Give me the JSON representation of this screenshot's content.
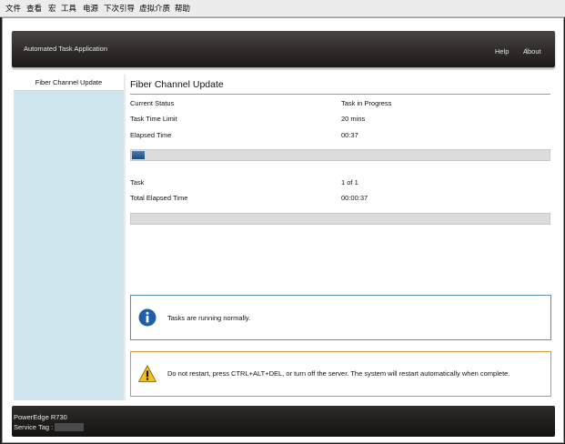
{
  "menu": [
    "文件",
    "查看",
    "宏",
    "工具",
    "电源",
    "下次引导",
    "虚拟介质",
    "帮助"
  ],
  "header": {
    "app_title": "Automated Task Application",
    "help": "Help",
    "about": "About",
    "separator": "|"
  },
  "sidebar": {
    "items": [
      {
        "label": "Fiber Channel Update"
      }
    ]
  },
  "main": {
    "title": "Fiber Channel Update",
    "current_status_label": "Current Status",
    "current_status_value": "Task in Progress",
    "time_limit_label": "Task Time Limit",
    "time_limit_value": "20 mins",
    "elapsed_label": "Elapsed Time",
    "elapsed_value": "00:37",
    "progress_current": 0.03,
    "task_label": "Task",
    "task_value": "1 of 1",
    "total_elapsed_label": "Total Elapsed Time",
    "total_elapsed_value": "00:00:37",
    "progress_total": 0.0
  },
  "messages": {
    "info": {
      "icon": "info-icon",
      "text": "Tasks are running normally."
    },
    "warning": {
      "icon": "warning-icon",
      "text": "Do not restart, press CTRL+ALT+DEL, or turn off the server.  The system will restart automatically when complete."
    }
  },
  "footer": {
    "model": "PowerEdge R730",
    "service_tag_label": "Service Tag :"
  },
  "colors": {
    "accent": "#1f4d7b",
    "sidebar_bg": "#cfe6ef",
    "info_border": "#5c8fb3",
    "warn_border": "#d49a3a"
  }
}
